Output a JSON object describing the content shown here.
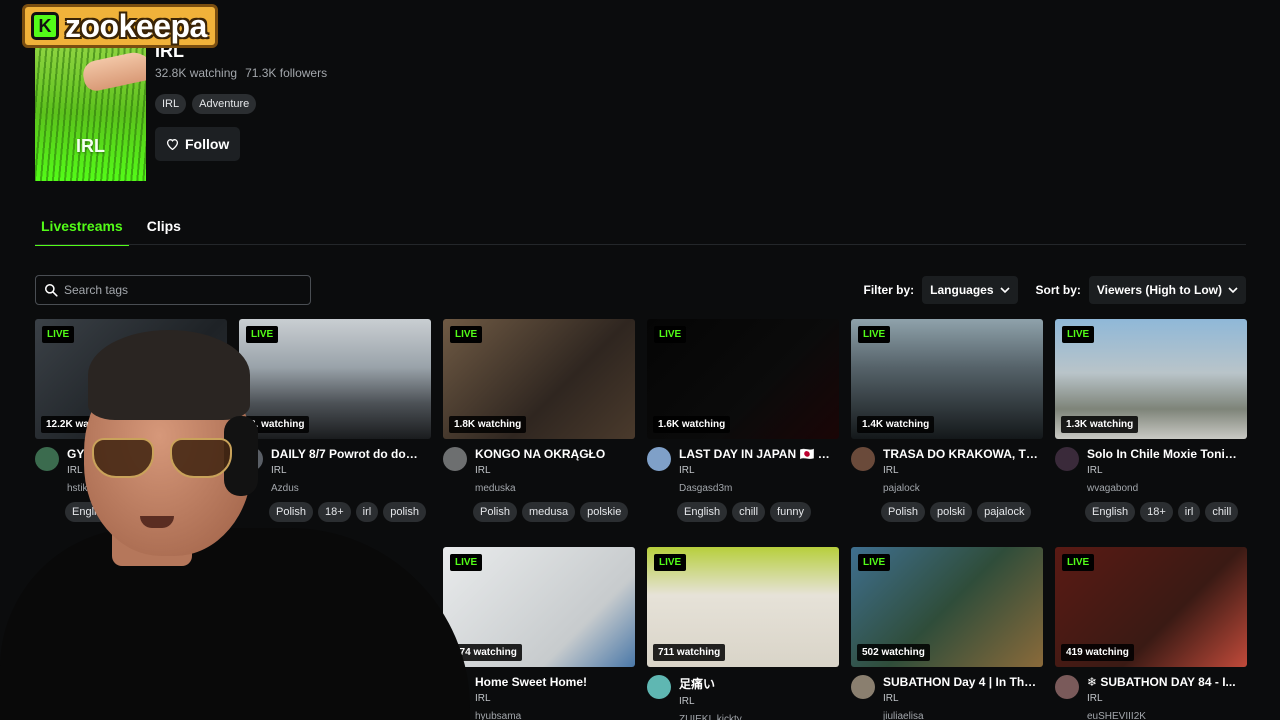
{
  "logo": {
    "badge": "K",
    "word": "zookeepa"
  },
  "category": {
    "thumb_label": "IRL",
    "title": "IRL",
    "watching": "32.8K watching",
    "followers": "71.3K followers",
    "tags": [
      "IRL",
      "Adventure"
    ],
    "follow_label": "Follow"
  },
  "tabs": [
    {
      "label": "Livestreams",
      "active": true
    },
    {
      "label": "Clips",
      "active": false
    }
  ],
  "search": {
    "placeholder": "Search tags",
    "value": ""
  },
  "filters": {
    "filter_label": "Filter by:",
    "languages": "Languages",
    "sort_label": "Sort by:",
    "sort_value": "Viewers (High to Low)"
  },
  "live_badge": "LIVE",
  "streams": [
    {
      "title": "GY…",
      "category": "IRL",
      "channel": "hstikky",
      "viewers": "12.2K wa",
      "tags": [
        "Englis"
      ],
      "avatar": "#3b6b4e"
    },
    {
      "title": "DAILY 8/7 Powrot do dom...",
      "category": "IRL",
      "channel": "Azdus",
      "viewers": "3.  watching",
      "tags": [
        "Polish",
        "18+",
        "irl",
        "polish"
      ],
      "avatar": "#5a5f66"
    },
    {
      "title": "KONGO NA OKRĄGŁO",
      "category": "IRL",
      "channel": "meduska",
      "viewers": "1.8K watching",
      "tags": [
        "Polish",
        "medusa",
        "polskie"
      ],
      "avatar": "#6d6f70"
    },
    {
      "title": "LAST DAY IN JAPAN 🇯🇵 M...",
      "category": "IRL",
      "channel": "Dasgasd3m",
      "viewers": "1.6K watching",
      "tags": [
        "English",
        "chill",
        "funny"
      ],
      "avatar": "#7fa0c8"
    },
    {
      "title": "TRASA DO KRAKOWA, TY...",
      "category": "IRL",
      "channel": "pajalock",
      "viewers": "1.4K watching",
      "tags": [
        "Polish",
        "polski",
        "pajalock"
      ],
      "avatar": "#6a4a3a"
    },
    {
      "title": "Solo In Chile Moxie Tonight",
      "category": "IRL",
      "channel": "wvagabond",
      "viewers": "1.3K watching",
      "tags": [
        "English",
        "18+",
        "irl",
        "chill"
      ],
      "avatar": "#3a2a3a"
    },
    {
      "title": "",
      "category": "",
      "channel": "",
      "viewers": "",
      "tags": [],
      "avatar": "#222"
    },
    {
      "title": "",
      "category": "",
      "channel": "",
      "viewers": "",
      "tags": [],
      "avatar": "#222"
    },
    {
      "title": "Home Sweet Home!",
      "category": "IRL",
      "channel": "hyubsama",
      "viewers": "974 watching",
      "tags": [],
      "avatar": "#4f7fa8"
    },
    {
      "title": "足痛い",
      "category": "IRL",
      "channel": "ZUIEKI_kickty",
      "viewers": "711 watching",
      "tags": [],
      "avatar": "#5fb7b2"
    },
    {
      "title": "SUBATHON Day 4 | In Tha...",
      "category": "IRL",
      "channel": "jiuliaelisa",
      "viewers": "502 watching",
      "tags": [],
      "avatar": "#8a7f6f"
    },
    {
      "title": "❄ SUBATHON DAY 84 - I...",
      "category": "IRL",
      "channel": "euSHEVIII2K",
      "viewers": "419 watching",
      "tags": [],
      "avatar": "#7a5a5a"
    }
  ]
}
